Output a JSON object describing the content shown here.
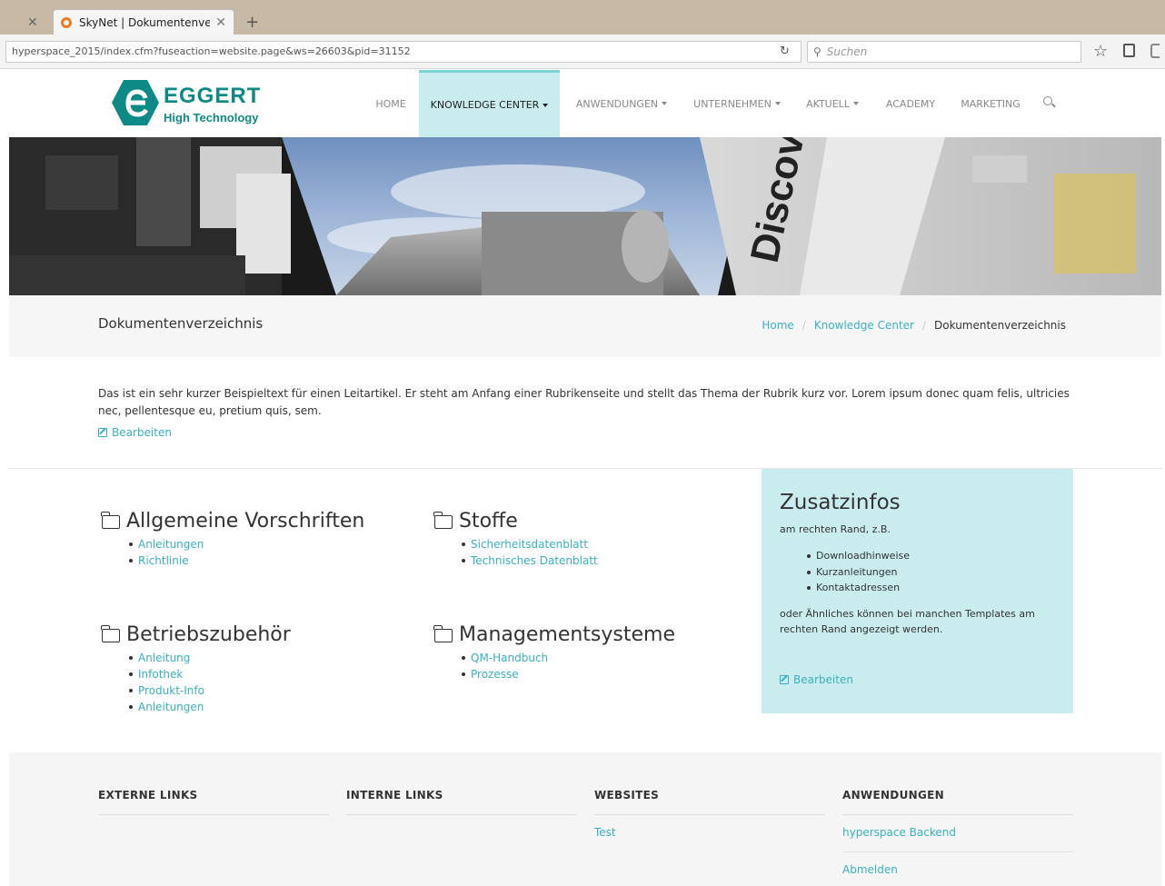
{
  "browser": {
    "tab_title": "SkyNet | Dokumentenverz...",
    "url": "hyperspace_2015/index.cfm?fuseaction=website.page&ws=26603&pid=31152",
    "search_placeholder": "Suchen"
  },
  "brand": {
    "name": "EGGERT",
    "tagline": "High Technology"
  },
  "nav": {
    "items": [
      {
        "label": "HOME"
      },
      {
        "label": "KNOWLEDGE CENTER"
      },
      {
        "label": "ANWENDUNGEN"
      },
      {
        "label": "UNTERNEHMEN"
      },
      {
        "label": "AKTUELL"
      },
      {
        "label": "ACADEMY"
      },
      {
        "label": "MARKETING"
      }
    ]
  },
  "page": {
    "title": "Dokumentenverzeichnis",
    "breadcrumb": [
      "Home",
      "Knowledge Center",
      "Dokumentenverzeichnis"
    ],
    "intro": "Das ist ein sehr kurzer Beispieltext für einen Leitartikel. Er steht am Anfang einer Rubrikenseite und stellt das Thema der Rubrik kurz vor. Lorem ipsum donec quam felis, ultricies nec, pellentesque eu, pretium quis, sem.",
    "edit_label": "Bearbeiten"
  },
  "categories": [
    {
      "title": "Allgemeine Vorschriften",
      "items": [
        "Anleitungen",
        "Richtlinie"
      ]
    },
    {
      "title": "Stoffe",
      "items": [
        "Sicherheitsdatenblatt",
        "Technisches Datenblatt"
      ]
    },
    {
      "title": "Betriebszubehör",
      "items": [
        "Anleitung",
        "Infothek",
        "Produkt-Info",
        "Anleitungen"
      ]
    },
    {
      "title": "Managementsysteme",
      "items": [
        "QM-Handbuch",
        "Prozesse"
      ]
    }
  ],
  "sidebar": {
    "title": "Zusatzinfos",
    "subtitle": "am rechten Rand, z.B.",
    "items": [
      "Downloadhinweise",
      "Kurzanleitungen",
      "Kontaktadressen"
    ],
    "text": "oder Ähnliches können bei manchen Templates am rechten Rand angezeigt werden.",
    "edit_label": "Bearbeiten"
  },
  "footer": {
    "columns": [
      {
        "title": "EXTERNE LINKS",
        "links": []
      },
      {
        "title": "INTERNE LINKS",
        "links": []
      },
      {
        "title": "WEBSITES",
        "links": [
          "Test"
        ]
      },
      {
        "title": "ANWENDUNGEN",
        "links": [
          "hyperspace Backend",
          "Abmelden"
        ]
      }
    ]
  }
}
